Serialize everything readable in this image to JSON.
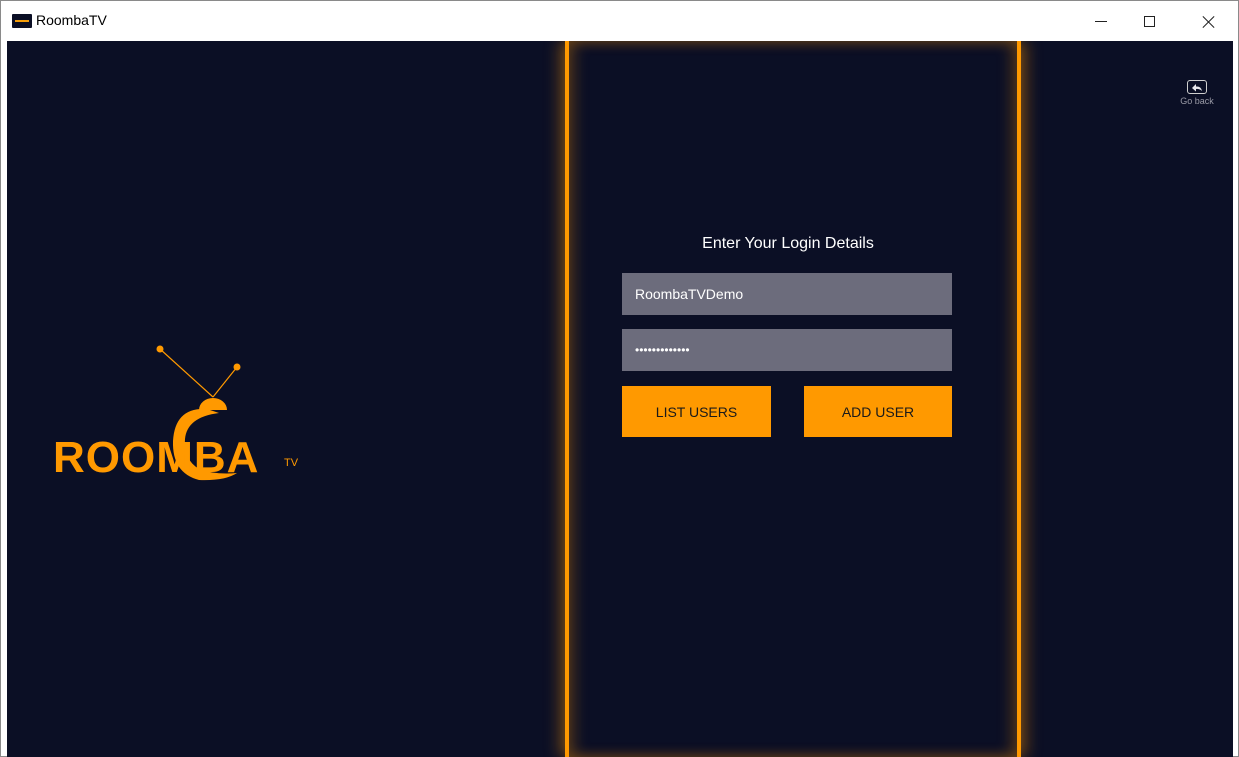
{
  "window": {
    "title": "RoombaTV"
  },
  "nav": {
    "go_back_label": "Go back"
  },
  "logo": {
    "brand_text": "ROOMBA",
    "brand_superscript": "TV"
  },
  "login": {
    "heading": "Enter Your Login Details",
    "username_value": "RoombaTVDemo",
    "password_masked": "•••••••••••••",
    "list_users_label": "LIST USERS",
    "add_user_label": "ADD USER"
  },
  "colors": {
    "background": "#0b0f25",
    "accent": "#ff9900",
    "field_bg": "#6c6c7c"
  }
}
